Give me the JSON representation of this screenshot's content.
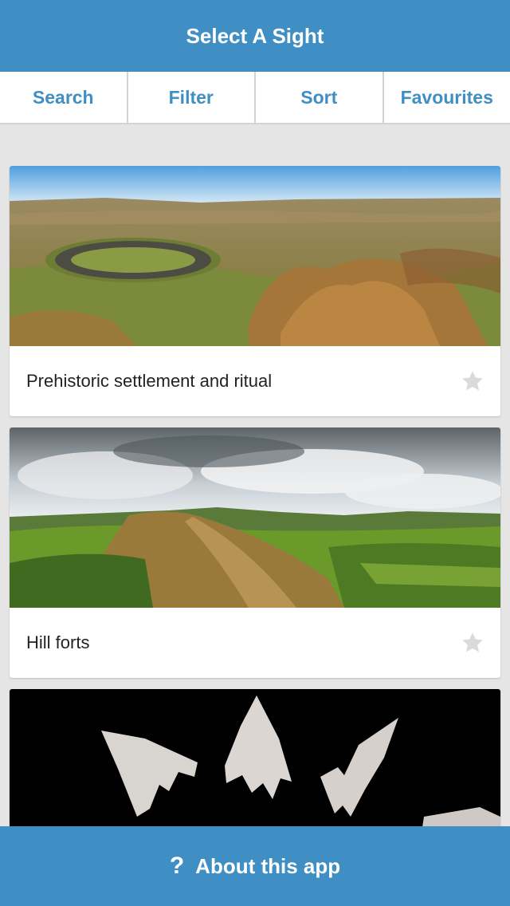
{
  "header": {
    "title": "Select A Sight"
  },
  "tabs": [
    {
      "label": "Search"
    },
    {
      "label": "Filter"
    },
    {
      "label": "Sort"
    },
    {
      "label": "Favourites"
    }
  ],
  "sights": [
    {
      "title": "Prehistoric settlement and ritual",
      "favourite": false
    },
    {
      "title": "Hill forts",
      "favourite": false
    },
    {
      "title": "",
      "favourite": false
    }
  ],
  "footer": {
    "icon": "question-icon",
    "glyph": "?",
    "label": "About this app"
  },
  "colors": {
    "accent": "#3f8fc4",
    "background": "#e5e5e5",
    "star_inactive": "#dadada"
  }
}
